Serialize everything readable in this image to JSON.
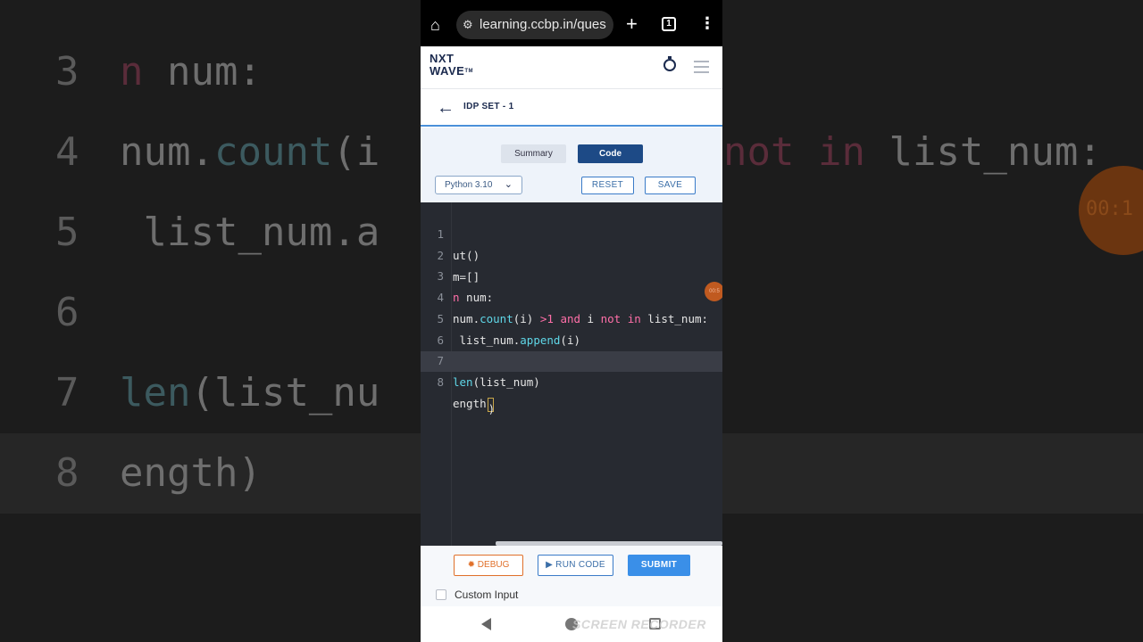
{
  "browser": {
    "url": "learning.ccbp.in/ques",
    "tab_count": "1"
  },
  "header": {
    "logo_line1": "NXT",
    "logo_line2": "WAVE",
    "logo_tm": "TM"
  },
  "subheader": {
    "title": "IDP SET - 1"
  },
  "toolbar": {
    "summary_tab": "Summary",
    "code_tab": "Code",
    "language": "Python 3.10",
    "reset_label": "RESET",
    "save_label": "SAVE"
  },
  "editor": {
    "lines": [
      {
        "num": "1",
        "text": "ut()"
      },
      {
        "num": "2",
        "text": "m=[]"
      },
      {
        "num": "3",
        "text": "n num:"
      },
      {
        "num": "4",
        "text": "num.count(i) >1 and i not in list_num:"
      },
      {
        "num": "5",
        "text": " list_num.append(i)"
      },
      {
        "num": "6",
        "text": ""
      },
      {
        "num": "7",
        "text": "len(list_num)"
      },
      {
        "num": "8",
        "text": "ength)"
      }
    ],
    "timer_badge": "00:5"
  },
  "footer": {
    "debug_label": "DEBUG",
    "run_label": "RUN CODE",
    "submit_label": "SUBMIT",
    "custom_input_label": "Custom Input"
  },
  "watermark": "SCREEN RECORDER",
  "background": {
    "timer_text": "00:1"
  },
  "colors": {
    "brand_navy": "#1d4a86",
    "accent_blue": "#3a8fe8",
    "debug_orange": "#e0702a",
    "editor_bg": "#272a31",
    "keyword_pink": "#ff6fa8",
    "function_cyan": "#5fd7e8"
  }
}
